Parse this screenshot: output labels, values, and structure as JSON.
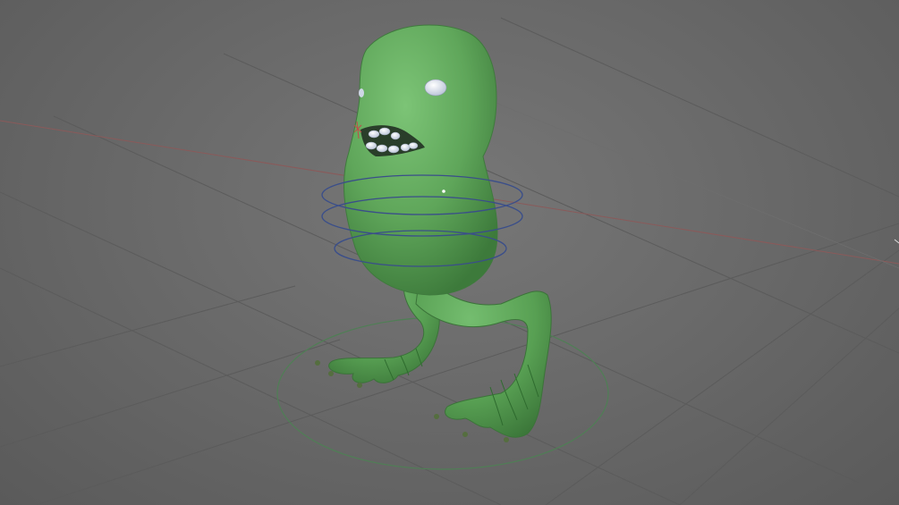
{
  "viewport": {
    "view": "perspective",
    "shading": "smooth-shaded",
    "grid_visible": true,
    "background_color": "#6a6a6a"
  },
  "model": {
    "type": "character",
    "body_color": "#5fa65a",
    "eye_color": "#cfd7e6",
    "teeth_color": "#d9dde6",
    "rig_ring_color": "#3a4e8a",
    "foot_control_color": "#4f7f55"
  }
}
